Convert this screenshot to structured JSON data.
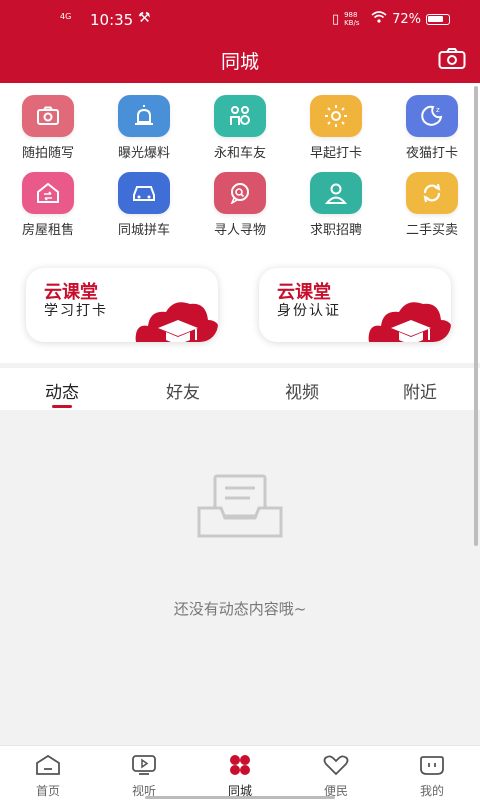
{
  "status_bar": {
    "network": "4G",
    "time": "10:35",
    "speed": "988 KB/s",
    "battery": "72%"
  },
  "header": {
    "title": "同城"
  },
  "grid": [
    {
      "label": "随拍随写",
      "icon": "camera-icon",
      "color": "#e16a7a"
    },
    {
      "label": "曝光爆料",
      "icon": "siren-icon",
      "color": "#4a90d9"
    },
    {
      "label": "永和车友",
      "icon": "people-icon",
      "color": "#35b8a5"
    },
    {
      "label": "早起打卡",
      "icon": "sun-icon",
      "color": "#f0b43c"
    },
    {
      "label": "夜猫打卡",
      "icon": "moon-icon",
      "color": "#5b7be0"
    },
    {
      "label": "房屋租售",
      "icon": "house-icon",
      "color": "#e95a8a"
    },
    {
      "label": "同城拼车",
      "icon": "car-icon",
      "color": "#3f6fd6"
    },
    {
      "label": "寻人寻物",
      "icon": "search-chat-icon",
      "color": "#d9536a"
    },
    {
      "label": "求职招聘",
      "icon": "person-icon",
      "color": "#33b2a0"
    },
    {
      "label": "二手买卖",
      "icon": "recycle-icon",
      "color": "#f1b83f"
    }
  ],
  "banners": [
    {
      "title": "云课堂",
      "subtitle": "学习打卡"
    },
    {
      "title": "云课堂",
      "subtitle": "身份认证"
    }
  ],
  "tabs": [
    {
      "label": "动态"
    },
    {
      "label": "好友"
    },
    {
      "label": "视频"
    },
    {
      "label": "附近"
    }
  ],
  "empty": {
    "text": "还没有动态内容哦~"
  },
  "bottom_nav": [
    {
      "label": "首页",
      "icon": "home-icon"
    },
    {
      "label": "视听",
      "icon": "play-icon"
    },
    {
      "label": "同城",
      "icon": "city-icon"
    },
    {
      "label": "便民",
      "icon": "heart-icon"
    },
    {
      "label": "我的",
      "icon": "profile-icon"
    }
  ],
  "colors": {
    "brand": "#c8102e"
  }
}
